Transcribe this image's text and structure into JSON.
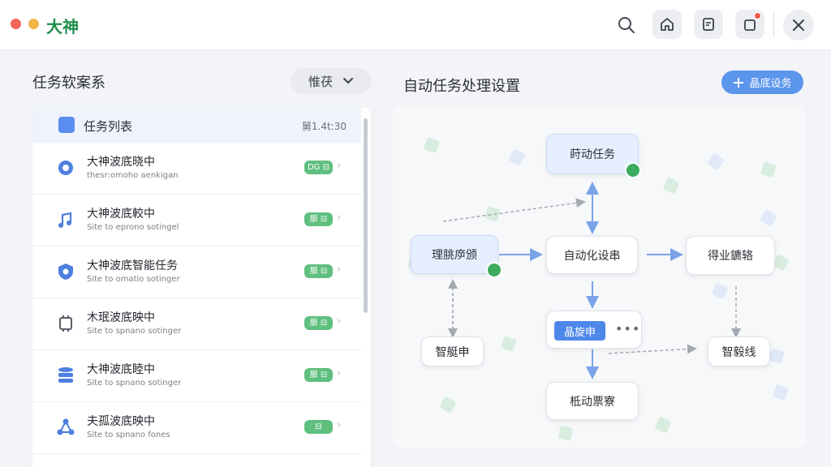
{
  "app": {
    "title": "大神"
  },
  "colors": {
    "accent": "#5b95ec",
    "brand": "#1f8f4a",
    "success": "#5fbf7f",
    "notify": "#ef5a4c"
  },
  "titlebar": {
    "icons": [
      "search-icon",
      "home-icon",
      "document-icon",
      "notification-icon",
      "close-icon"
    ]
  },
  "left": {
    "title": "任务软案系",
    "filter_label": "惟茯",
    "list_header": {
      "label": "任务列表",
      "count": "舅1.4t:30"
    },
    "items": [
      {
        "title": "大神波底晓中",
        "sub": "thesr:omoho aenkigan",
        "badge": "DG ⊟",
        "icon": "gear-icon"
      },
      {
        "title": "大神波底較中",
        "sub": "Site to eprono sotingel",
        "badge": "脈 ⊟",
        "icon": "music-note-icon"
      },
      {
        "title": "大神波底智能任务",
        "sub": "Site to omatio sotinger",
        "badge": "脈 ⊟",
        "icon": "shield-icon"
      },
      {
        "title": "木珉波底映中",
        "sub": "Site to spnano sotinger",
        "badge": "脈 ⊟",
        "icon": "chip-icon"
      },
      {
        "title": "大神波底睦中",
        "sub": "Site to spnano sotinger",
        "badge": "脈 ⊟",
        "icon": "database-icon"
      },
      {
        "title": "夫孤波底映中",
        "sub": "Site to spnano fones",
        "badge": "⊟",
        "icon": "share-icon"
      }
    ]
  },
  "right": {
    "title": "自动任务处理设置",
    "create_label": "晶底设务",
    "nodes": {
      "top": "莳动任务",
      "left": "理脁㡿颁",
      "center": "自动化设串",
      "right": "得业鑣辂",
      "pill": "晶旋申",
      "pill_more": "•••",
      "bottom_left": "智艇申",
      "bottom_right": "智毅线",
      "bottom": "柢动票寮"
    }
  }
}
